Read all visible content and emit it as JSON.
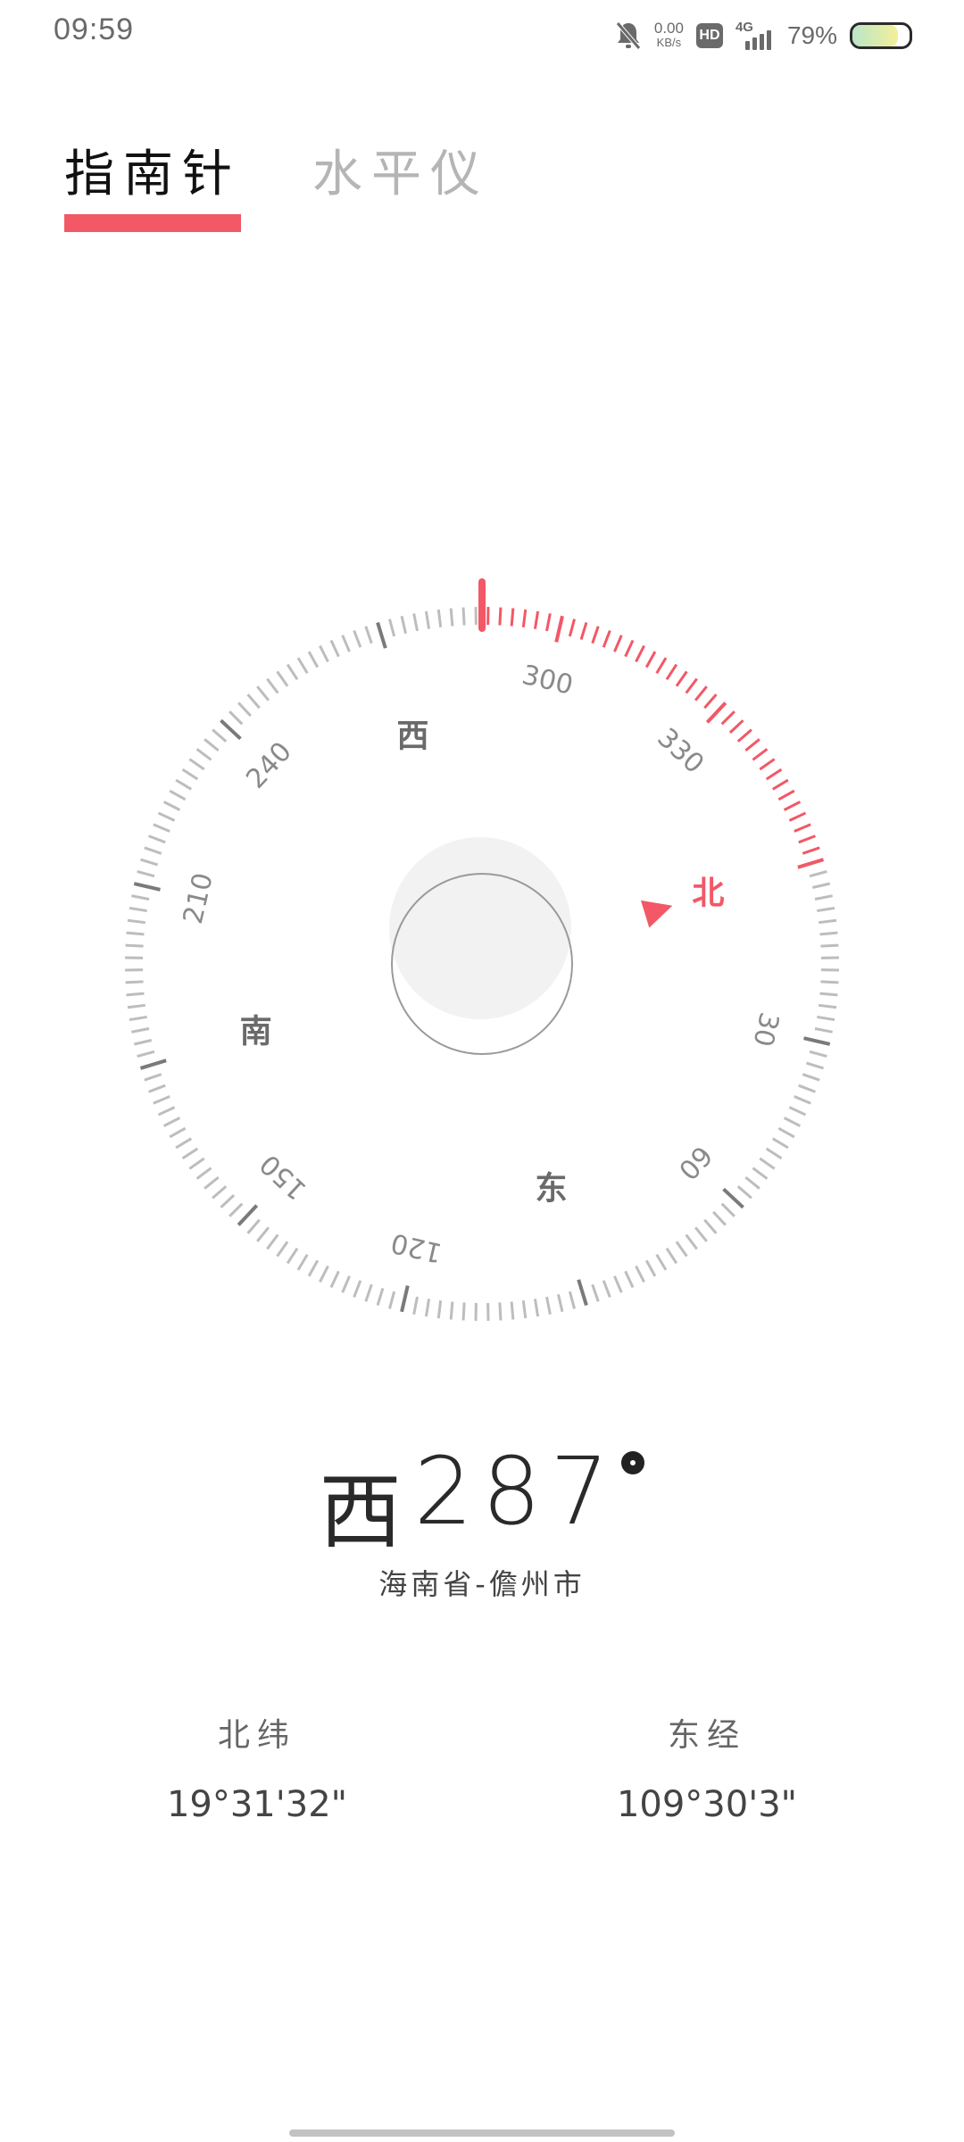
{
  "status_bar": {
    "time": "09:59",
    "net_speed_value": "0.00",
    "net_speed_unit": "KB/s",
    "hd_label": "HD",
    "network_label": "4G",
    "battery_percent_text": "79%",
    "battery_level": 0.79,
    "icons": [
      "mute-bell-icon",
      "hd-icon",
      "signal-icon",
      "battery-icon"
    ]
  },
  "tabs": [
    {
      "label": "指南针",
      "active": true
    },
    {
      "label": "水平仪",
      "active": false
    }
  ],
  "compass": {
    "heading_degrees": 287,
    "cardinal_labels": {
      "north": "北",
      "east": "东",
      "south": "南",
      "west": "西"
    },
    "degree_labels": [
      "30",
      "60",
      "120",
      "150",
      "210",
      "240",
      "300",
      "330"
    ],
    "accent_color": "#f25866",
    "tick_color": "#bdbdbd"
  },
  "reading": {
    "direction": "西",
    "degrees": "287"
  },
  "location": "海南省-儋州市",
  "coordinates": {
    "latitude": {
      "label": "北纬",
      "value": "19°31'32\""
    },
    "longitude": {
      "label": "东经",
      "value": "109°30'3\""
    }
  }
}
